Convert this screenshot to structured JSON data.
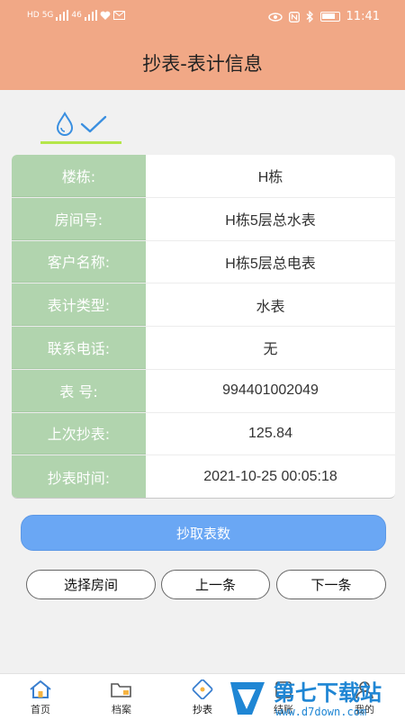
{
  "status_bar": {
    "left_text": [
      "HD",
      "5G",
      "46",
      "HD"
    ],
    "time": "11:41"
  },
  "header": {
    "title": "抄表-表计信息"
  },
  "info": {
    "rows": [
      {
        "label": "楼栋:",
        "value": "H栋"
      },
      {
        "label": "房间号:",
        "value": "H栋5层总水表"
      },
      {
        "label": "客户名称:",
        "value": "H栋5层总电表"
      },
      {
        "label": "表计类型:",
        "value": "水表"
      },
      {
        "label": "联系电话:",
        "value": "无"
      },
      {
        "label": "表 号:",
        "value": "994401002049"
      },
      {
        "label": "上次抄表:",
        "value": "125.84"
      },
      {
        "label": "抄表时间:",
        "value": "2021-10-25 00:05:18"
      }
    ]
  },
  "actions": {
    "read_button": "抄取表数",
    "select_room": "选择房间",
    "previous": "上一条",
    "next": "下一条"
  },
  "tabbar": {
    "items": [
      {
        "label": "首页",
        "icon": "home-icon"
      },
      {
        "label": "档案",
        "icon": "folder-icon"
      },
      {
        "label": "抄表",
        "icon": "meter-reading-icon"
      },
      {
        "label": "结账",
        "icon": "checkout-icon"
      },
      {
        "label": "我的",
        "icon": "user-icon"
      }
    ]
  },
  "watermark": {
    "brand": "第七下载站",
    "url": "www.d7down.com"
  },
  "colors": {
    "header": "#f1a886",
    "label_bg": "#b1d4ae",
    "primary": "#6aa7f4",
    "tab_underline": "#b5e64a"
  }
}
